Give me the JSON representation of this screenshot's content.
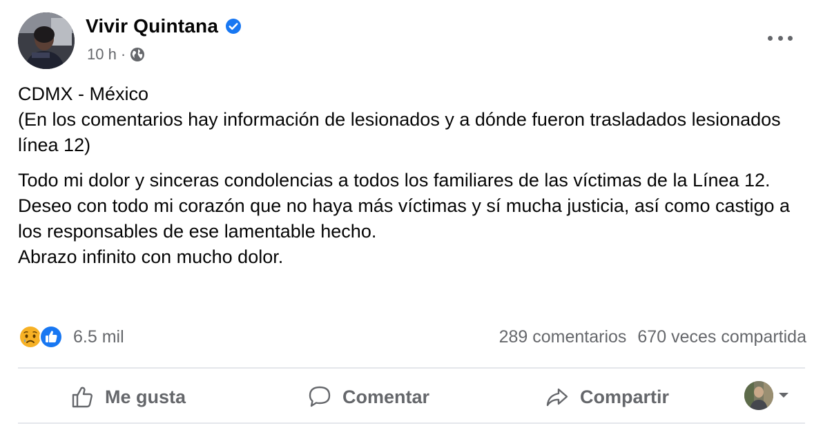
{
  "post": {
    "author": {
      "name": "Vivir Quintana",
      "verified": true
    },
    "meta": {
      "time": "10 h",
      "separator": "·",
      "audience_icon": "globe-icon"
    },
    "text": {
      "line1": "CDMX - México",
      "line2": "(En los comentarios hay información de lesionados y a dónde fueron trasladados lesionados línea 12)",
      "line3": "Todo mi dolor y sinceras condolencias a todos los familiares de las víctimas de la Línea 12.",
      "line4": "Deseo con todo mi corazón que no haya más víctimas y sí mucha justicia, así como castigo a los responsables de ese lamentable hecho.",
      "line5": "Abrazo infinito con mucho dolor."
    },
    "reactions": {
      "icons": [
        "sad-reaction-icon",
        "like-reaction-icon"
      ],
      "count": "6.5 mil",
      "comments": "289 comentarios",
      "shares": "670 veces compartida"
    },
    "actions": {
      "like_label": "Me gusta",
      "comment_label": "Comentar",
      "share_label": "Compartir"
    }
  },
  "colors": {
    "text_primary": "#050505",
    "text_secondary": "#65676b",
    "verified_blue": "#1877f2",
    "divider": "#e4e6eb",
    "sad_yellow": "#f7b125"
  }
}
